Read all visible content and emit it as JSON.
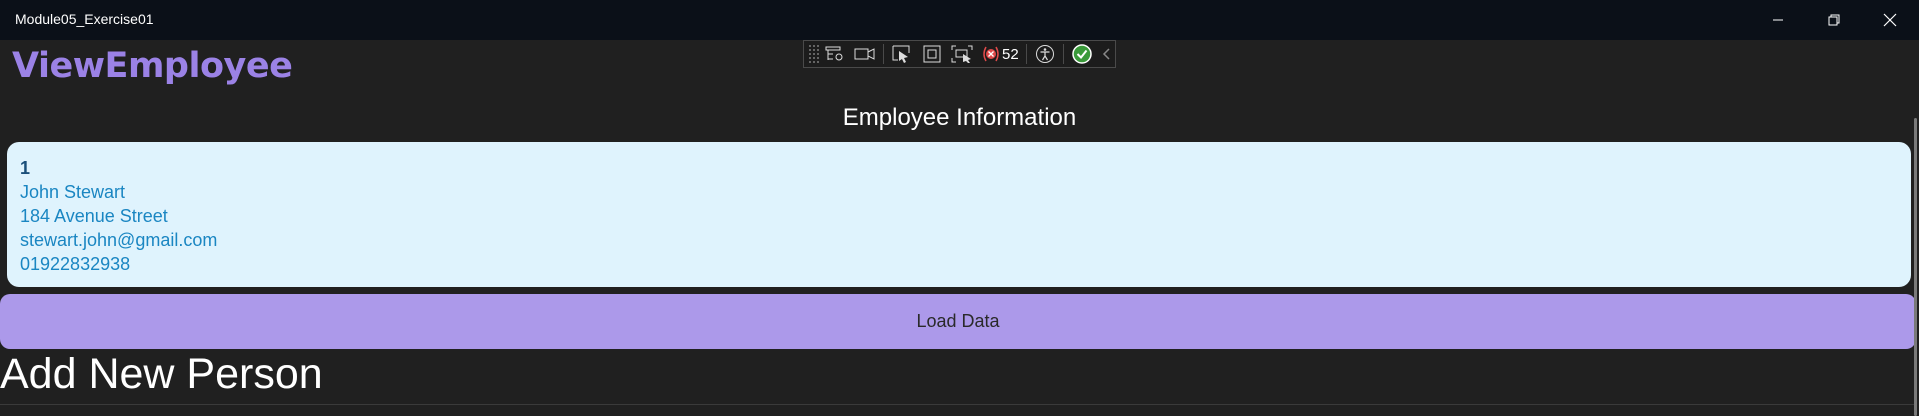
{
  "window": {
    "title": "Module05_Exercise01",
    "controls": {
      "minimize_icon": "minimize-icon",
      "maximize_icon": "restore-icon",
      "close_icon": "close-icon"
    }
  },
  "app": {
    "title": "ViewEmployee",
    "title_color": "#9b82e6"
  },
  "debug_toolbar": {
    "icons": [
      "live-visual-tree-icon",
      "video-icon",
      "select-element-icon",
      "display-layout-adorners-icon",
      "track-focus-icon",
      "binding-failures-icon",
      "accessibility-icon",
      "check-icon",
      "chevron-left-icon"
    ],
    "binding_failures_count": "52"
  },
  "employee_section": {
    "heading": "Employee Information",
    "employee": {
      "id": "1",
      "name": "John Stewart",
      "address": "184 Avenue Street",
      "email": "stewart.john@gmail.com",
      "phone": "01922832938"
    },
    "card_bg": "#dff3fd",
    "text_color": "#1a86c2"
  },
  "load_button": {
    "label": "Load Data",
    "bg": "#ac99ea"
  },
  "add_section": {
    "heading": "Add New Person"
  }
}
